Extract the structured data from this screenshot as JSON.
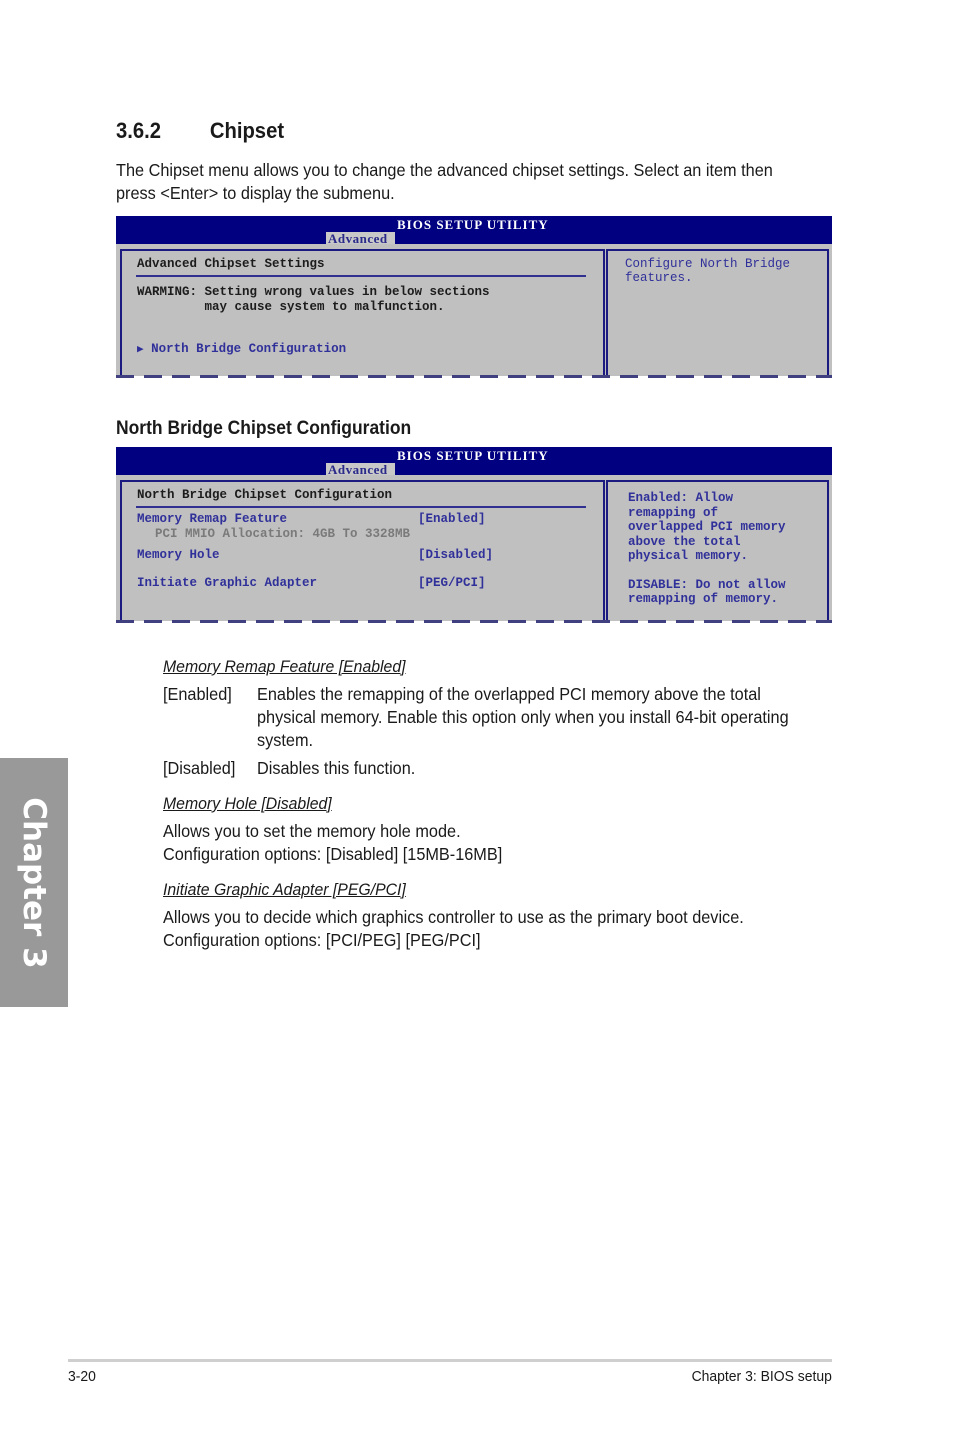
{
  "section": {
    "number": "3.6.2",
    "title": "Chipset",
    "intro_line1": "The Chipset menu allows you to change the advanced chipset settings. Select an item then",
    "intro_line2": "press <Enter> to display the submenu."
  },
  "bios1": {
    "title": "BIOS SETUP UTILITY",
    "tab": "Advanced",
    "heading": "Advanced Chipset Settings",
    "warning_line1": "WARMING: Setting wrong values in below sections",
    "warning_line2": "         may cause system to malfunction.",
    "submenu_arrow": "▶",
    "submenu_item": "North Bridge Configuration",
    "help_line1": "Configure North Bridge",
    "help_line2": "features."
  },
  "subsection": {
    "title": "North Bridge Chipset Configuration"
  },
  "bios2": {
    "title": "BIOS SETUP UTILITY",
    "tab": "Advanced",
    "heading": "North Bridge Chipset Configuration",
    "items": [
      {
        "label": "Memory Remap Feature",
        "value": "[Enabled]"
      },
      {
        "label": "Memory Hole",
        "value": "[Disabled]"
      },
      {
        "label": "Initiate Graphic Adapter",
        "value": "[PEG/PCI]"
      }
    ],
    "info_line": "PCI MMIO Allocation: 4GB To 3328MB",
    "help": [
      "Enabled: Allow",
      "remapping of",
      "overlapped PCI memory",
      "above the total",
      "physical memory.",
      "DISABLE: Do not allow",
      "remapping of memory."
    ]
  },
  "descriptions": {
    "remap": {
      "title": "Memory Remap Feature [Enabled]",
      "opt1_label": "[Enabled]",
      "opt1_line1": "Enables the remapping of the overlapped PCI memory above the total",
      "opt1_line2": "physical memory. Enable this option only when you install 64-bit operating",
      "opt1_line3": "system.",
      "opt2_label": "[Disabled]",
      "opt2_line1": "Disables this function."
    },
    "hole": {
      "title": "Memory Hole [Disabled]",
      "line1": "Allows you to set the memory hole mode.",
      "line2": "Configuration options: [Disabled] [15MB-16MB]"
    },
    "graphic": {
      "title": "Initiate Graphic Adapter [PEG/PCI]",
      "line1": "Allows you to decide which graphics controller to use as the primary boot device.",
      "line2": "Configuration options: [PCI/PEG] [PEG/PCI]"
    }
  },
  "sidebar": {
    "chapter_label": "Chapter 3"
  },
  "footer": {
    "page_number": "3-20",
    "chapter_title": "Chapter 3: BIOS setup"
  },
  "colors": {
    "bios_blue": "#000080",
    "bios_grey": "#c0c0c0",
    "bios_text_blue": "#30309a",
    "chapter_tab": "#999999"
  }
}
